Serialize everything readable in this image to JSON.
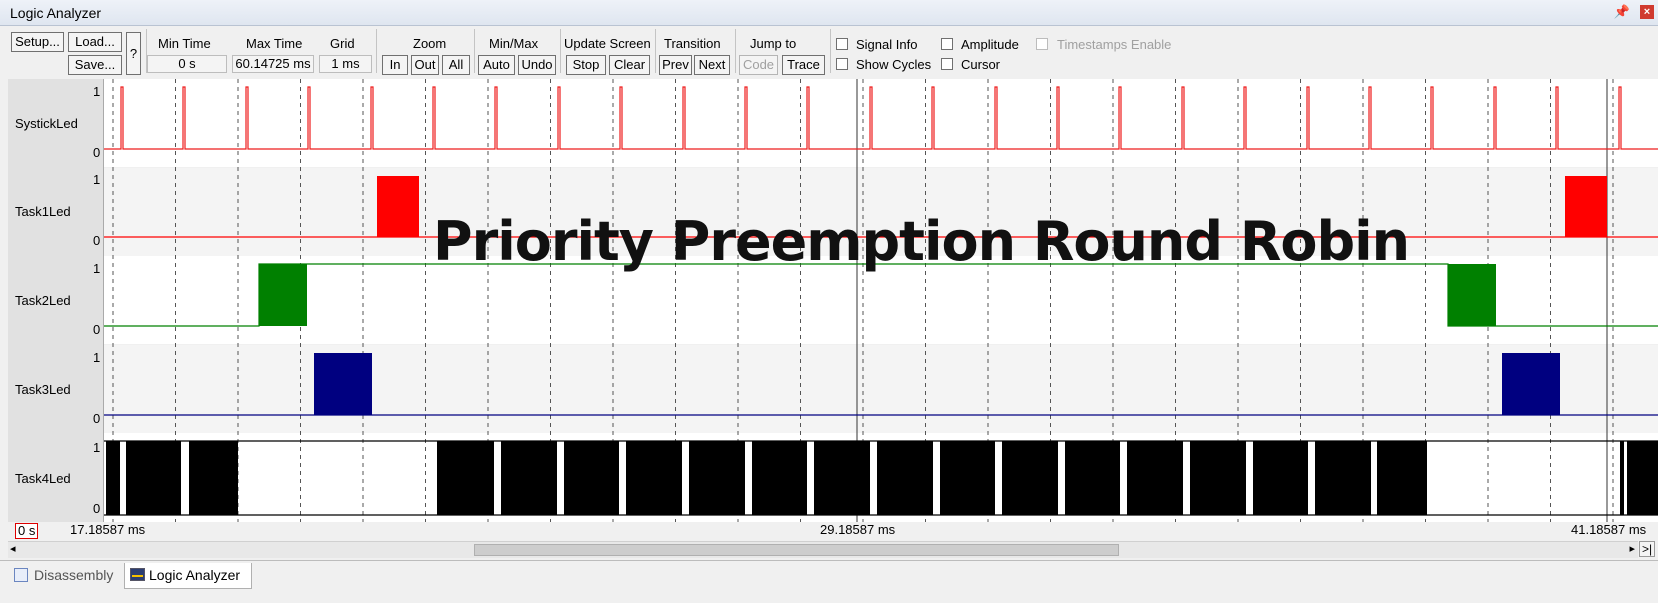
{
  "window": {
    "title": "Logic Analyzer",
    "pin_icon": "pin-icon",
    "close_icon": "close-icon"
  },
  "toolbar": {
    "setup": "Setup...",
    "load": "Load...",
    "save": "Save...",
    "help": "?",
    "min_time_label": "Min Time",
    "min_time_value": "0 s",
    "max_time_label": "Max Time",
    "max_time_value": "60.14725 ms",
    "grid_label": "Grid",
    "grid_value": "1 ms",
    "zoom_label": "Zoom",
    "zoom_in": "In",
    "zoom_out": "Out",
    "zoom_all": "All",
    "minmax_label": "Min/Max",
    "minmax_auto": "Auto",
    "minmax_undo": "Undo",
    "update_label": "Update Screen",
    "update_stop": "Stop",
    "update_clear": "Clear",
    "transition_label": "Transition",
    "transition_prev": "Prev",
    "transition_next": "Next",
    "jump_label": "Jump to",
    "jump_code": "Code",
    "jump_trace": "Trace",
    "signal_info": "Signal Info",
    "show_cycles": "Show Cycles",
    "amplitude": "Amplitude",
    "cursor": "Cursor",
    "timestamps": "Timestamps Enable"
  },
  "signals": [
    {
      "name": "SystickLed",
      "high": "1",
      "low": "0",
      "color": "#ee1c1c"
    },
    {
      "name": "Task1Led",
      "high": "1",
      "low": "0",
      "color": "#ff0000"
    },
    {
      "name": "Task2Led",
      "high": "1",
      "low": "0",
      "color": "#008000"
    },
    {
      "name": "Task3Led",
      "high": "1",
      "low": "0",
      "color": "#000080"
    },
    {
      "name": "Task4Led",
      "high": "1",
      "low": "0",
      "color": "#000000"
    }
  ],
  "overlay_text": "Priority Preemption Round Robin",
  "timebar": {
    "origin": "0 s",
    "left": "17.18587 ms",
    "center": "29.18587 ms",
    "right": "41.18587 ms"
  },
  "scroll": {
    "right_end": ">|"
  },
  "tabs": [
    {
      "label": "Disassembly",
      "icon": "disassembly-icon",
      "active": false
    },
    {
      "label": "Logic Analyzer",
      "icon": "logic-analyzer-icon",
      "active": true
    }
  ]
}
